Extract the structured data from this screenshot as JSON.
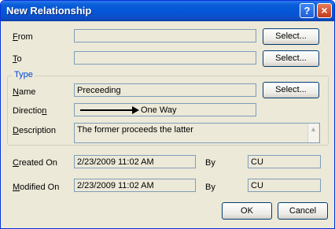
{
  "window": {
    "title": "New Relationship",
    "help_glyph": "?",
    "close_glyph": "×"
  },
  "from": {
    "label_u": "F",
    "label_rest": "rom",
    "value": "",
    "select": "Select..."
  },
  "to": {
    "label_u": "T",
    "label_rest": "o",
    "value": "",
    "select": "Select..."
  },
  "type": {
    "group_title": "Type",
    "name_label_u": "N",
    "name_label_rest": "ame",
    "name_value": "Preceeding",
    "name_select": "Select...",
    "direction_label_pre": "Directio",
    "direction_label_u": "n",
    "direction_value": "One Way",
    "description_label_u": "D",
    "description_label_rest": "escription",
    "description_value": "The former proceeds the latter",
    "scroll_icon": "up-arrow"
  },
  "created": {
    "label_u": "C",
    "label_rest": "reated On",
    "value": "2/23/2009 11:02 AM",
    "by_label": "By",
    "by_value": "CU"
  },
  "modified": {
    "label_u": "M",
    "label_rest": "odified On",
    "value": "2/23/2009 11:02 AM",
    "by_label": "By",
    "by_value": "CU"
  },
  "buttons": {
    "ok": "OK",
    "cancel": "Cancel"
  }
}
